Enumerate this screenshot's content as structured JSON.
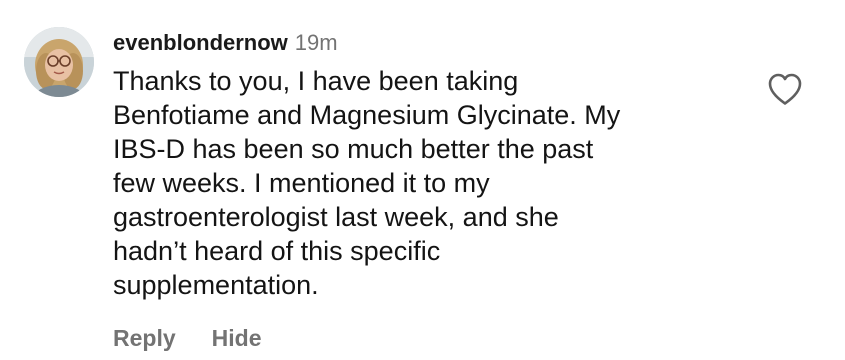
{
  "comment": {
    "username": "evenblondernow",
    "timestamp": "19m",
    "text": "Thanks to you, I have been taking\nBenfotiame and Magnesium Glycinate. My\nIBS-D has been so much better the past\nfew weeks. I mentioned it to my\ngastroenterologist last week, and she\nhadn’t heard of this specific\nsupplementation.",
    "actions": {
      "reply_label": "Reply",
      "hide_label": "Hide"
    },
    "like_icon": "heart-outline-icon"
  },
  "colors": {
    "text": "#141414",
    "secondary": "#737373",
    "background": "#ffffff"
  }
}
